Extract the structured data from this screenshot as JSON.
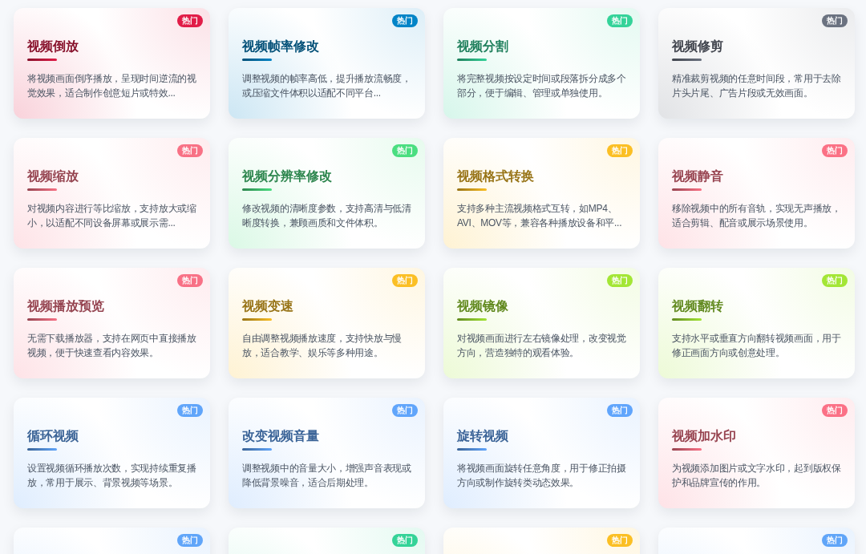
{
  "cards": [
    {
      "badge": "热门",
      "color": "#e11d48",
      "title": "视频倒放",
      "description": "将视频画面倒序播放，呈现时间逆流的视觉效果，适合制作创意短片或特效..."
    },
    {
      "badge": "热门",
      "color": "#0284c7",
      "title": "视频帧率修改",
      "description": "调整视频的帧率高低，提升播放流畅度，或压缩文件体积以适配不同平台..."
    },
    {
      "badge": "热门",
      "color": "#34d399",
      "title": "视频分割",
      "description": "将完整视频按设定时间或段落拆分成多个部分，便于编辑、管理或单独使用。"
    },
    {
      "badge": "热门",
      "color": "#6b7280",
      "title": "视频修剪",
      "description": "精准裁剪视频的任意时间段，常用于去除片头片尾、广告片段或无效画面。"
    },
    {
      "badge": "热门",
      "color": "#f87185",
      "title": "视频缩放",
      "description": "对视频内容进行等比缩放，支持放大或缩小，以适配不同设备屏幕或展示需..."
    },
    {
      "badge": "热门",
      "color": "#4ade80",
      "title": "视频分辨率修改",
      "description": "修改视频的清晰度参数，支持高清与低清晰度转换，兼顾画质和文件体积。"
    },
    {
      "badge": "热门",
      "color": "#fbbf24",
      "title": "视频格式转换",
      "description": "支持多种主流视频格式互转，如MP4、AVI、MOV等，兼容各种播放设备和平..."
    },
    {
      "badge": "热门",
      "color": "#fb7185",
      "title": "视频静音",
      "description": "移除视频中的所有音轨，实现无声播放，适合剪辑、配音或展示场景使用。"
    },
    {
      "badge": "热门",
      "color": "#f87186",
      "title": "视频播放预览",
      "description": "无需下载播放器，支持在网页中直接播放视频，便于快速查看内容效果。"
    },
    {
      "badge": "热门",
      "color": "#fbbf25",
      "title": "视频变速",
      "description": "自由调整视频播放速度，支持快放与慢放，适合教学、娱乐等多种用途。"
    },
    {
      "badge": "热门",
      "color": "#a3e635",
      "title": "视频镜像",
      "description": "对视频画面进行左右镜像处理，改变视觉方向，营造独特的观看体验。"
    },
    {
      "badge": "热门",
      "color": "#a3e636",
      "title": "视频翻转",
      "description": "支持水平或垂直方向翻转视频画面，用于修正画面方向或创意处理。"
    },
    {
      "badge": "热门",
      "color": "#60a5fa",
      "title": "循环视频",
      "description": "设置视频循环播放次数，实现持续重复播放，常用于展示、背景视频等场景。"
    },
    {
      "badge": "热门",
      "color": "#60a5fb",
      "title": "改变视频音量",
      "description": "调整视频中的音量大小，增强声音表现或降低背景噪音，适合后期处理。"
    },
    {
      "badge": "热门",
      "color": "#60a5fc",
      "title": "旋转视频",
      "description": "将视频画面旋转任意角度，用于修正拍摄方向或制作旋转类动态效果。"
    },
    {
      "badge": "热门",
      "color": "#fb7186",
      "title": "视频加水印",
      "description": "为视频添加图片或文字水印，起到版权保护和品牌宣传的作用。"
    },
    {
      "badge": "热门",
      "color": "#60a5f9"
    },
    {
      "badge": "热门",
      "color": "#34d398"
    },
    {
      "badge": "热门",
      "color": "#fbbf23"
    },
    {
      "badge": "热门",
      "color": "#60a5f8"
    }
  ]
}
